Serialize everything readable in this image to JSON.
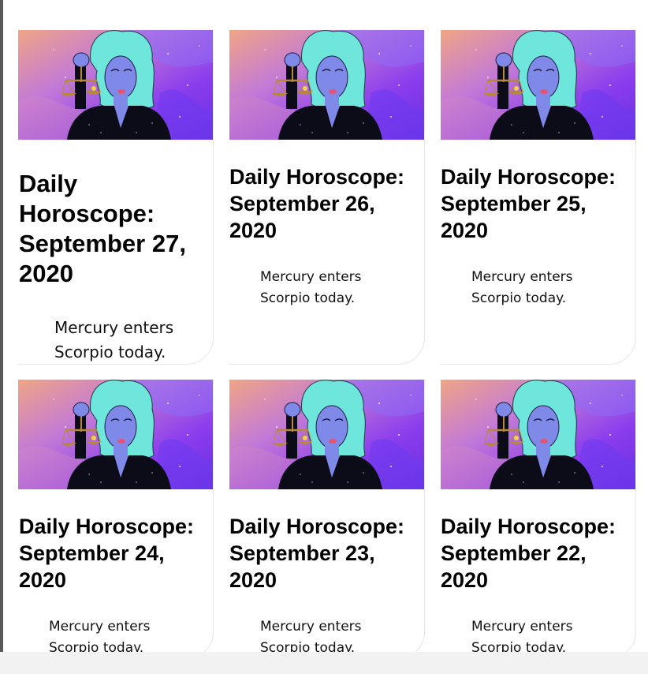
{
  "cards": [
    {
      "title_lines": [
        "Daily",
        "Horoscope:",
        "September 27,",
        "2020"
      ],
      "excerpt_lines": [
        "Mercury enters",
        "Scorpio today."
      ],
      "image": "libra-zodiac-illustration"
    },
    {
      "title_lines": [
        "Daily Horoscope:",
        "September 26,",
        "2020"
      ],
      "excerpt_lines": [
        "Mercury enters",
        "Scorpio today."
      ],
      "image": "libra-zodiac-illustration"
    },
    {
      "title_lines": [
        "Daily Horoscope:",
        "September 25,",
        "2020"
      ],
      "excerpt_lines": [
        "Mercury enters",
        "Scorpio today."
      ],
      "image": "libra-zodiac-illustration"
    },
    {
      "title_lines": [
        "Daily Horoscope:",
        "September 24,",
        "2020"
      ],
      "excerpt_lines": [
        "Mercury enters",
        "Scorpio today."
      ],
      "image": "libra-zodiac-illustration"
    },
    {
      "title_lines": [
        "Daily Horoscope:",
        "September 23,",
        "2020"
      ],
      "excerpt_lines": [
        "Mercury enters",
        "Scorpio today."
      ],
      "image": "libra-zodiac-illustration"
    },
    {
      "title_lines": [
        "Daily Horoscope:",
        "September 22,",
        "2020"
      ],
      "excerpt_lines": [
        "Mercury enters",
        "Scorpio today."
      ],
      "image": "libra-zodiac-illustration"
    }
  ],
  "colors": {
    "bg_purple": "#7a2fe8",
    "bg_peach": "#f0a585",
    "hair": "#6fe6dc",
    "skin": "#7f8ae8",
    "dress": "#0c0c18",
    "scale_gold": "#b7883c",
    "lips": "#e25577"
  }
}
